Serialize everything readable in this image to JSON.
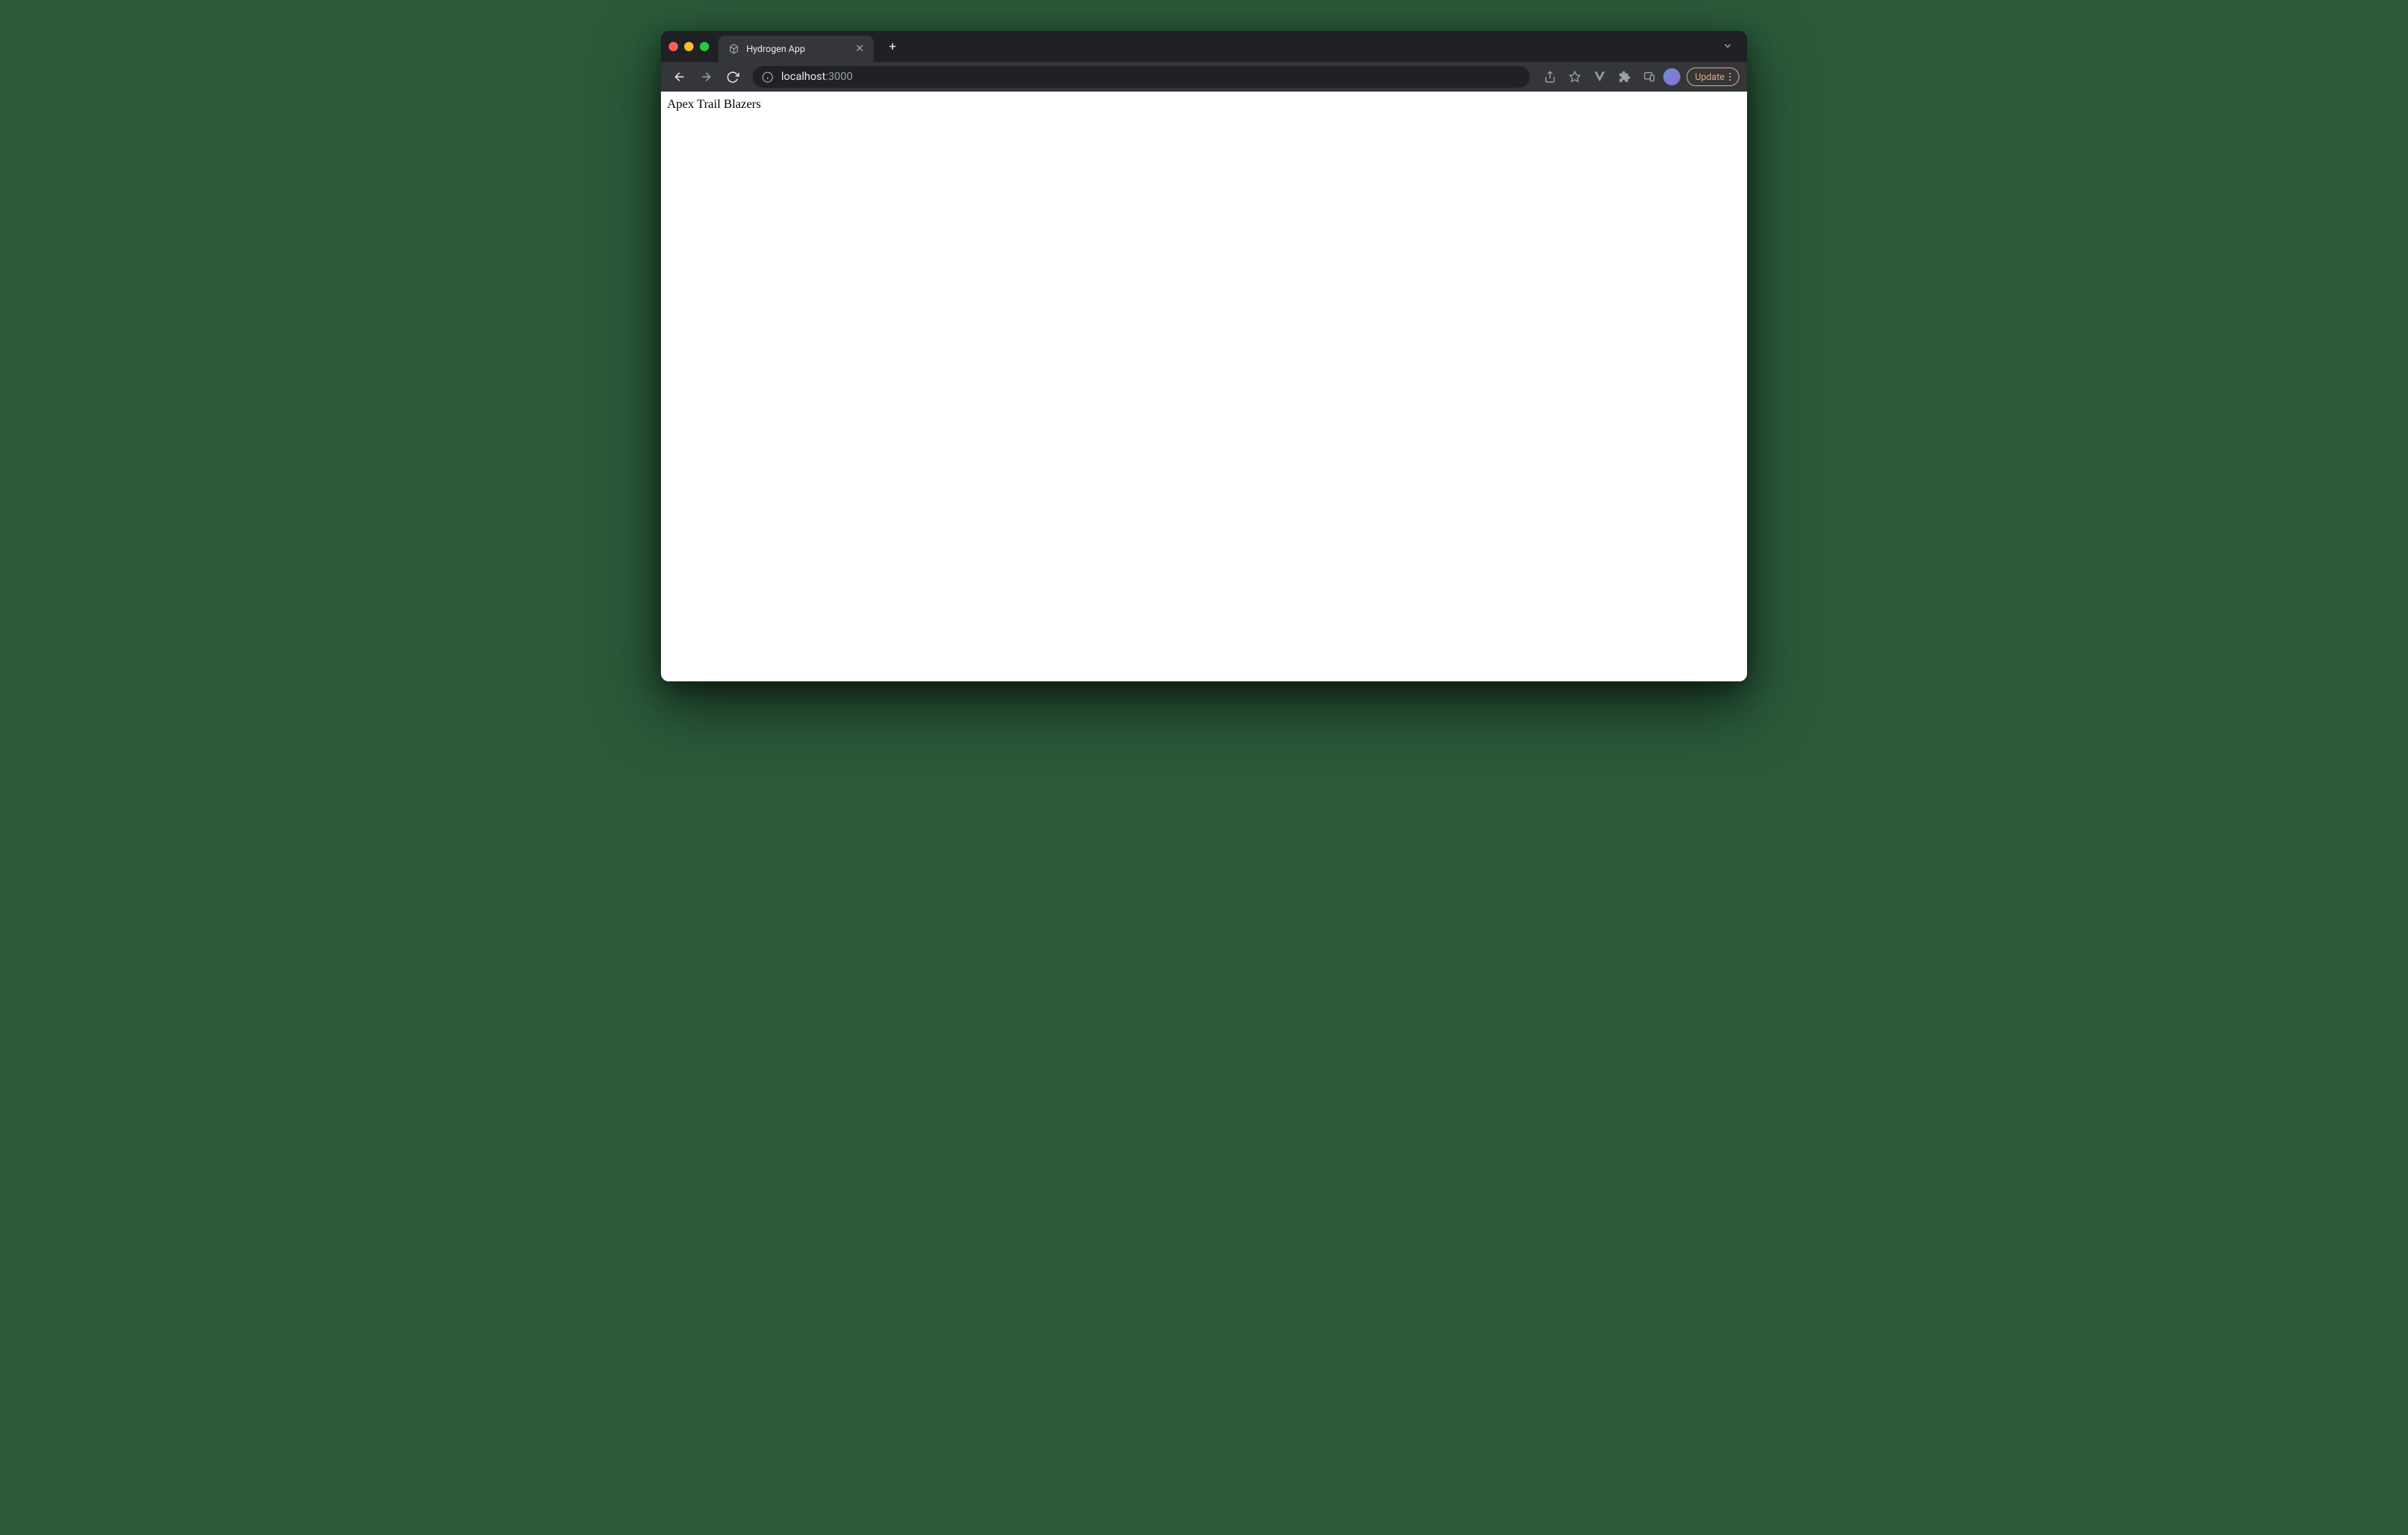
{
  "browser": {
    "tab": {
      "title": "Hydrogen App"
    },
    "address": {
      "host": "localhost",
      "port": ":3000"
    },
    "update_button_label": "Update"
  },
  "page": {
    "body_text": "Apex Trail Blazers"
  }
}
